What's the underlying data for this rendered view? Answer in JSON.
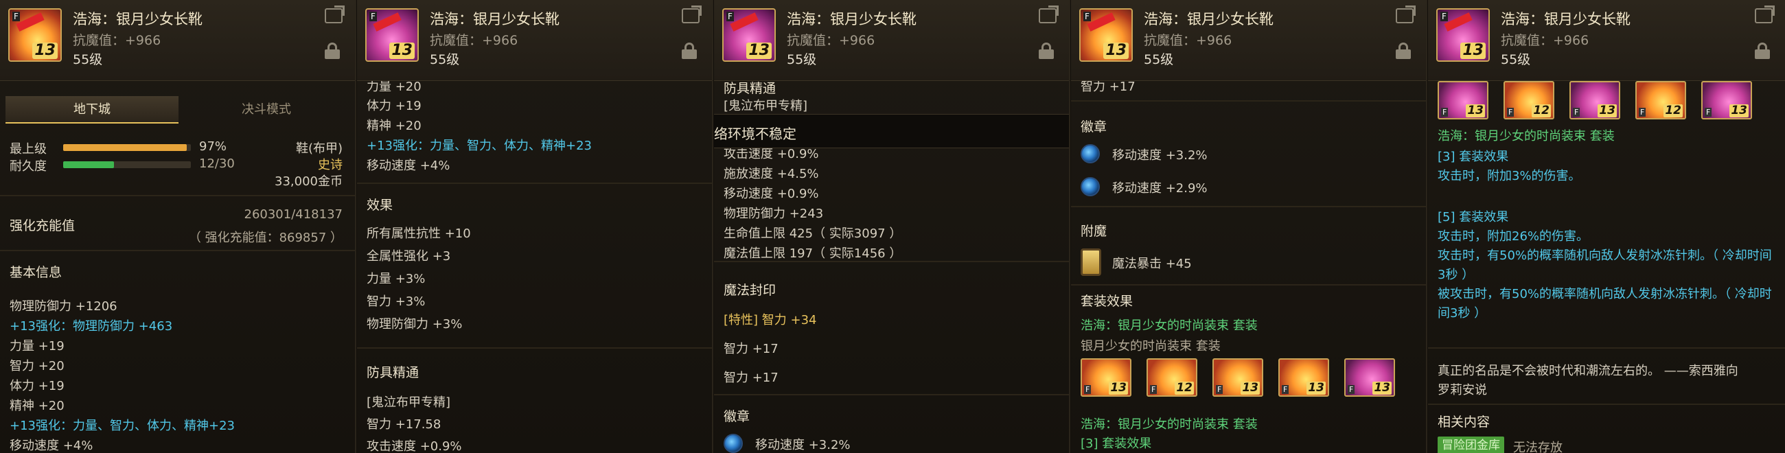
{
  "header": {
    "title": "浩海：银月少女长靴",
    "resist": "抗魔值：+966",
    "level": "55级",
    "thumb_level": "13"
  },
  "p1": {
    "tabs": [
      "地下城",
      "决斗模式"
    ],
    "max_level_label": "最上级",
    "max_level_pct": "97%",
    "max_level_fill": 0.97,
    "durability_label": "耐久度",
    "durability_val": "12/30",
    "durability_fill": 0.4,
    "item_type": "鞋(布甲)",
    "rarity": "史诗",
    "price": "33,000金币",
    "charge_label": "强化充能值",
    "charge_val": "260301/418137",
    "charge_sub": "（ 强化充能值：869857 ）",
    "basic_title": "基本信息",
    "lines": [
      {
        "text": "物理防御力 +1206",
        "cls": "w"
      },
      {
        "text": "+13强化：物理防御力 +463",
        "cls": "c"
      },
      {
        "text": "力量 +19",
        "cls": "w"
      },
      {
        "text": "智力 +20",
        "cls": "w"
      },
      {
        "text": "体力 +19",
        "cls": "w"
      },
      {
        "text": "精神 +20",
        "cls": "w"
      },
      {
        "text": "+13强化：力量、智力、体力、精神+23",
        "cls": "c"
      },
      {
        "text": "移动速度 +4%",
        "cls": "w"
      }
    ]
  },
  "p2": {
    "top_cut": "力量 +20",
    "lines1": [
      {
        "text": "体力 +19",
        "cls": "w"
      },
      {
        "text": "精神 +20",
        "cls": "w"
      },
      {
        "text": "+13强化：力量、智力、体力、精神+23",
        "cls": "c"
      },
      {
        "text": "移动速度 +4%",
        "cls": "w"
      }
    ],
    "effect_title": "效果",
    "effects": [
      "所有属性抗性 +10",
      "全属性强化 +3",
      "力量 +3%",
      "智力 +3%",
      "物理防御力 +3%"
    ],
    "mastery_title": "防具精通",
    "mastery": [
      "[鬼泣布甲专精]",
      "智力 +17.58",
      "攻击速度 +0.9%"
    ]
  },
  "p3": {
    "top_cut": "防具精通",
    "top_cut2": "[鬼泣布甲专精]",
    "popup": "络环境不稳定",
    "lines": [
      "攻击速度 +0.9%",
      "施放速度 +4.5%",
      "移动速度 +0.9%",
      "物理防御力 +243",
      "生命值上限 425（ 实际3097 ）",
      "魔法值上限 197（ 实际1456 ）"
    ],
    "seal_title": "魔法封印",
    "seal_special": "[特性] 智力 +34",
    "seal_lines": [
      "智力 +17",
      "智力 +17"
    ],
    "emblem_title": "徽章",
    "emblem_line": "移动速度 +3.2%"
  },
  "p4": {
    "top_cut": "智力 +17",
    "emblem_title": "徽章",
    "emblems": [
      "移动速度 +3.2%",
      "移动速度 +2.9%"
    ],
    "enchant_title": "附魔",
    "enchant": "魔法暴击 +45",
    "set_title": "套装效果",
    "set_name": "浩海：银月少女的时尚装束 套装",
    "set_name_gray": "银月少女的时尚装束 套装",
    "set_levels": [
      "13",
      "12",
      "13",
      "13",
      "13"
    ],
    "set_name2": "浩海：银月少女的时尚装束 套装",
    "set_effect": "[3] 套装效果"
  },
  "p5": {
    "set_levels": [
      "13",
      "12",
      "13",
      "12",
      "13"
    ],
    "set_name": "浩海：银月少女的时尚装束 套装",
    "e3_title": "[3] 套装效果",
    "e3_line": "攻击时，附加3%的伤害。",
    "e5_title": "[5] 套装效果",
    "e5_lines": [
      "攻击时，附加26%的伤害。",
      "攻击时，有50%的概率随机向敌人发射冰冻针刺。（ 冷却时间",
      "3秒 ）",
      "被攻击时，有50%的概率随机向敌人发射冰冻针刺。（ 冷却时",
      "间3秒 ）"
    ],
    "quote1": "真正的名品是不会被时代和潮流左右的。 ——索西雅向",
    "quote2": "罗莉安说",
    "related_title": "相关内容",
    "badge": "冒险团金库",
    "badge_note": "无法存放"
  }
}
